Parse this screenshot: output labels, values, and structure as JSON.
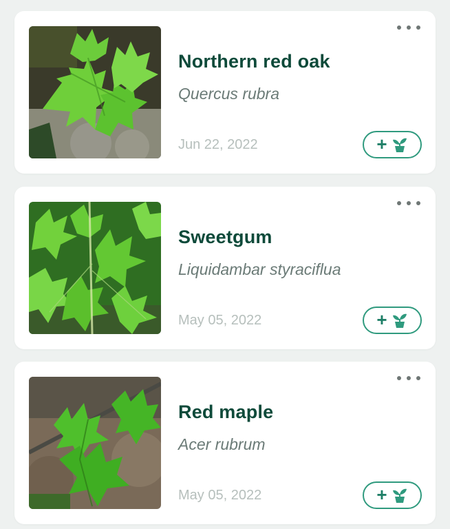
{
  "colors": {
    "accent": "#2f9a7e",
    "title": "#0e4a3a",
    "subtitle": "#6b7b77",
    "date": "#b6bfbc",
    "background": "#eef1f0",
    "card": "#ffffff"
  },
  "icons": {
    "more": "more-horizontal-icon",
    "plus": "plus-icon",
    "plant": "potted-plant-icon"
  },
  "plants": [
    {
      "common_name": "Northern red oak",
      "scientific_name": "Quercus rubra",
      "date": "Jun 22, 2022",
      "add_symbol": "+"
    },
    {
      "common_name": "Sweetgum",
      "scientific_name": "Liquidambar styraciflua",
      "date": "May 05, 2022",
      "add_symbol": "+"
    },
    {
      "common_name": "Red maple",
      "scientific_name": "Acer rubrum",
      "date": "May 05, 2022",
      "add_symbol": "+"
    }
  ]
}
